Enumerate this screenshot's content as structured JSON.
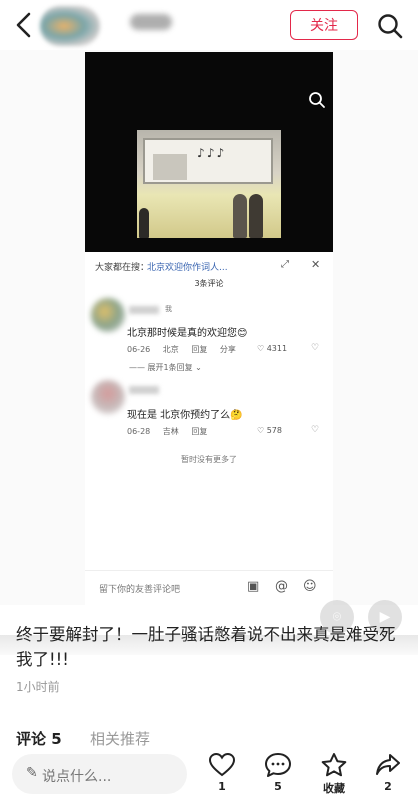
{
  "header": {
    "follow_label": "关注"
  },
  "inner": {
    "search_prefix": "大家都在搜：",
    "search_keyword": "北京欢迎你作词人...",
    "comment_count": "3条评论",
    "comments": [
      {
        "text": "北京那时候是真的欢迎您😊",
        "date": "06-26",
        "location": "北京",
        "reply": "回复",
        "share": "分享",
        "likes": "4311"
      },
      {
        "text": "现在是 北京你预约了么🤔",
        "date": "06-28",
        "location": "吉林",
        "reply": "回复",
        "likes": "578"
      }
    ],
    "expand_label": "展开1条回复",
    "no_more": "暂时没有更多了",
    "input_placeholder": "留下你的友善评论吧"
  },
  "post": {
    "text": "终于要解封了！一肚子骚话憋着说不出来真是难受死我了!!!",
    "time": "1小时前"
  },
  "tabs": {
    "comments": "评论 5",
    "related": "相关推荐"
  },
  "bottom": {
    "input_placeholder": "说点什么...",
    "like_count": "1",
    "comment_count": "5",
    "collect_label": "收藏",
    "share_count": "2"
  },
  "colors": {
    "accent": "#e3284a"
  }
}
